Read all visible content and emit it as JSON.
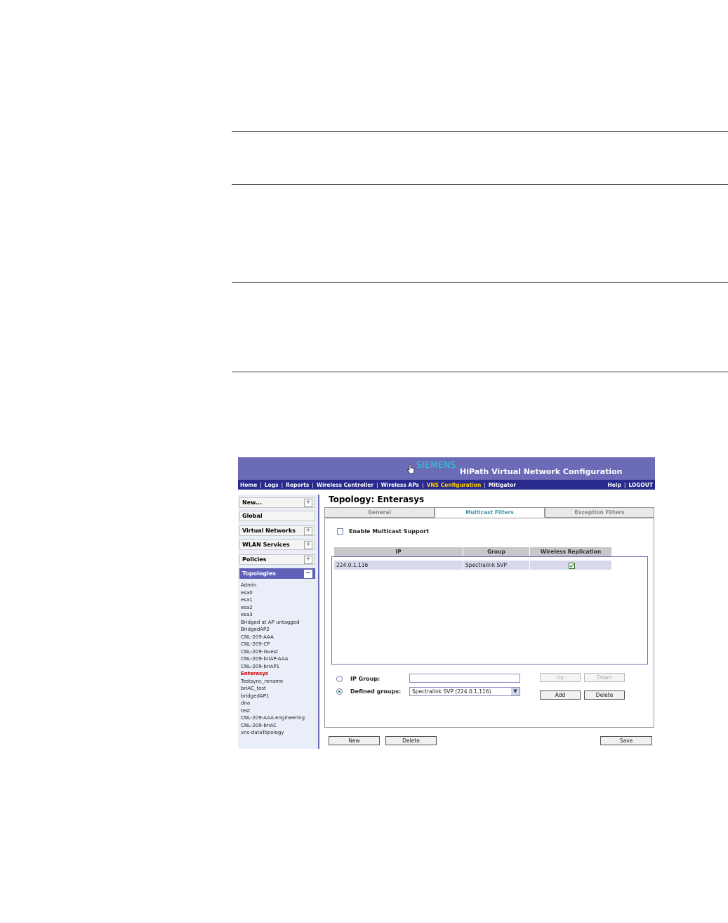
{
  "app": {
    "brand": "SIEMENS",
    "title": "HiPath Virtual Network Configuration"
  },
  "nav": {
    "items": [
      "Home",
      "Logs",
      "Reports",
      "Wireless Controller",
      "Wireless APs",
      "VNS Configuration",
      "Mitigator"
    ],
    "active": "VNS Configuration",
    "right_items": [
      "Help",
      "LOGOUT"
    ]
  },
  "sidebar": {
    "sections": [
      {
        "label": "New...",
        "toggle": "+"
      },
      {
        "label": "Global",
        "toggle": ""
      },
      {
        "label": "Virtual Networks",
        "toggle": "+"
      },
      {
        "label": "WLAN Services",
        "toggle": "+"
      },
      {
        "label": "Policies",
        "toggle": "+"
      },
      {
        "label": "Topologies",
        "toggle": "−"
      }
    ],
    "topologies": [
      "Admin",
      "esa0",
      "esa1",
      "esa2",
      "esa3",
      "Bridged at AP untagged",
      "BridgedAP2",
      "CNL-209-AAA",
      "CNL-209-CP",
      "CNL-209-Guest",
      "CNL-209-briAP-AAA",
      "CNL-209-briAP1",
      "Enterasys",
      "Testsync_rename",
      "briAC_test",
      "bridgedAP1",
      "dna",
      "test",
      "CNL-209-AAA:engineering",
      "CNL-209-briAC",
      "vns-dataTopology"
    ],
    "selected": "Enterasys"
  },
  "main": {
    "title": "Topology: Enterasys",
    "tabs": [
      "General",
      "Multicast Filters",
      "Exception Filters"
    ],
    "active_tab": "Multicast Filters",
    "enable_multicast_label": "Enable Multicast Support",
    "enable_multicast_checked": false,
    "table": {
      "columns": [
        "IP",
        "Group",
        "Wireless Replication"
      ],
      "rows": [
        {
          "ip": "224.0.1.116",
          "group": "Spectralink SVP",
          "wireless_replication": true
        }
      ]
    },
    "ip_group_label": "IP Group:",
    "ip_group_value": "",
    "defined_groups_label": "Defined groups:",
    "defined_groups_value": "Spectralink SVP (224.0.1.116)",
    "selected_option": "defined_groups",
    "buttons": {
      "up": "Up",
      "down": "Down",
      "add": "Add",
      "delete": "Delete"
    }
  },
  "footer": {
    "new": "New",
    "delete": "Delete",
    "save": "Save"
  },
  "colors": {
    "banner": "#6b6bb8",
    "navbar": "#2a2a8c",
    "active_nav": "#ffd400",
    "brand": "#22d3d3",
    "selected_topology": "#cc0000",
    "active_tab_text": "#3a9aa8"
  }
}
